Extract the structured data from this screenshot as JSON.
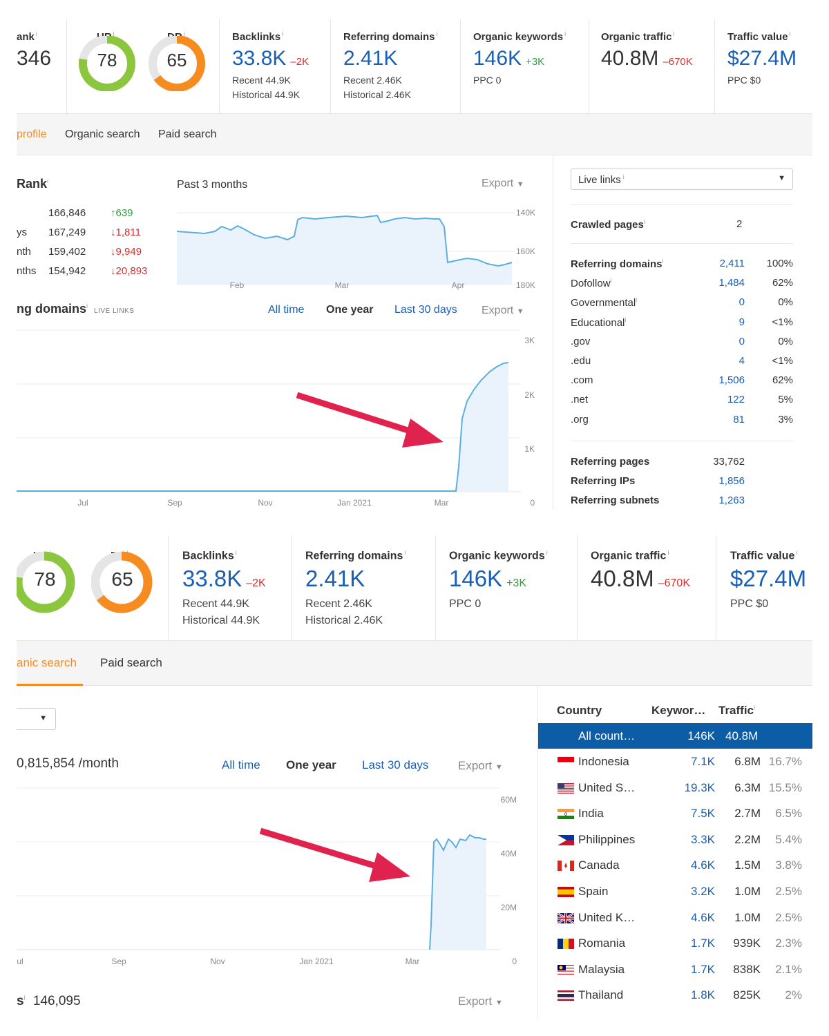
{
  "panel1": {
    "metrics": {
      "rank_label": "ank",
      "rank_value": "346",
      "ur_label": "UR",
      "ur_value": "78",
      "dr_label": "DR",
      "dr_value": "65",
      "backlinks_label": "Backlinks",
      "backlinks_value": "33.8K",
      "backlinks_delta": "–2K",
      "backlinks_recent": "Recent 44.9K",
      "backlinks_historical": "Historical 44.9K",
      "refdomains_label": "Referring domains",
      "refdomains_value": "2.41K",
      "refdomains_recent": "Recent 2.46K",
      "refdomains_historical": "Historical 2.46K",
      "keywords_label": "Organic keywords",
      "keywords_value": "146K",
      "keywords_delta": "+3K",
      "keywords_ppc": "PPC 0",
      "traffic_label": "Organic traffic",
      "traffic_value": "40.8M",
      "traffic_delta": "–670K",
      "value_label": "Traffic value",
      "value_value": "$27.4M",
      "value_ppc": "PPC $0"
    },
    "tabs": [
      "profile",
      "Organic search",
      "Paid search"
    ],
    "rank": {
      "title": "Rank",
      "period": "Past 3 months",
      "export": "Export",
      "rows": [
        {
          "label": "",
          "value": "166,846",
          "change": "↑639",
          "dir": "up"
        },
        {
          "label": "ys",
          "value": "167,249",
          "change": "↓1,811",
          "dir": "down"
        },
        {
          "label": "nth",
          "value": "159,402",
          "change": "↓9,949",
          "dir": "down"
        },
        {
          "label": "nths",
          "value": "154,942",
          "change": "↓20,893",
          "dir": "down"
        }
      ],
      "y_ticks": [
        "140K",
        "160K",
        "180K"
      ],
      "x_ticks": [
        "Feb",
        "Mar",
        "Apr"
      ]
    },
    "refdomains_chart": {
      "title": "ng domains",
      "badge": "LIVE LINKS",
      "filters": [
        "All time",
        "One year",
        "Last 30 days"
      ],
      "export": "Export",
      "y_ticks": [
        "3K",
        "2K",
        "1K",
        "0"
      ],
      "x_ticks": [
        "Jul",
        "Sep",
        "Nov",
        "Jan 2021",
        "Mar"
      ]
    },
    "sidebar": {
      "select_label": "Live links",
      "crawled_label": "Crawled pages",
      "crawled_value": "2",
      "rows": [
        {
          "label": "Referring domains",
          "value": "2,411",
          "pct": "100%",
          "bold": true
        },
        {
          "label": "Dofollow",
          "value": "1,484",
          "pct": "62%",
          "info": true
        },
        {
          "label": "Governmental",
          "value": "0",
          "pct": "0%",
          "info": true
        },
        {
          "label": "Educational",
          "value": "9",
          "pct": "<1%",
          "info": true
        },
        {
          "label": ".gov",
          "value": "0",
          "pct": "0%"
        },
        {
          "label": ".edu",
          "value": "4",
          "pct": "<1%"
        },
        {
          "label": ".com",
          "value": "1,506",
          "pct": "62%"
        },
        {
          "label": ".net",
          "value": "122",
          "pct": "5%"
        },
        {
          "label": ".org",
          "value": "81",
          "pct": "3%"
        }
      ],
      "bottom": [
        {
          "label": "Referring pages",
          "value": "33,762"
        },
        {
          "label": "Referring IPs",
          "value": "1,856"
        },
        {
          "label": "Referring subnets",
          "value": "1,263"
        }
      ]
    }
  },
  "panel2": {
    "tabs": [
      "anic search",
      "Paid search"
    ],
    "traffic_line": "0,815,854 /month",
    "filters": [
      "All time",
      "One year",
      "Last 30 days"
    ],
    "export": "Export",
    "y_ticks": [
      "60M",
      "40M",
      "20M",
      "0"
    ],
    "x_ticks": [
      "ul",
      "Sep",
      "Nov",
      "Jan 2021",
      "Mar"
    ],
    "keywords_line": "146,095",
    "country_table": {
      "headers": [
        "Country",
        "Keywor…",
        "Traffic"
      ],
      "all_row": {
        "name": "All count…",
        "keywords": "146K",
        "traffic": "40.8M"
      },
      "rows": [
        {
          "name": "Indonesia",
          "keywords": "7.1K",
          "traffic": "6.8M",
          "pct": "16.7%",
          "flag": "id"
        },
        {
          "name": "United S…",
          "keywords": "19.3K",
          "traffic": "6.3M",
          "pct": "15.5%",
          "flag": "us"
        },
        {
          "name": "India",
          "keywords": "7.5K",
          "traffic": "2.7M",
          "pct": "6.5%",
          "flag": "in"
        },
        {
          "name": "Philippines",
          "keywords": "3.3K",
          "traffic": "2.2M",
          "pct": "5.4%",
          "flag": "ph"
        },
        {
          "name": "Canada",
          "keywords": "4.6K",
          "traffic": "1.5M",
          "pct": "3.8%",
          "flag": "ca"
        },
        {
          "name": "Spain",
          "keywords": "3.2K",
          "traffic": "1.0M",
          "pct": "2.5%",
          "flag": "es"
        },
        {
          "name": "United K…",
          "keywords": "4.6K",
          "traffic": "1.0M",
          "pct": "2.5%",
          "flag": "gb"
        },
        {
          "name": "Romania",
          "keywords": "1.7K",
          "traffic": "939K",
          "pct": "2.3%",
          "flag": "ro"
        },
        {
          "name": "Malaysia",
          "keywords": "1.7K",
          "traffic": "838K",
          "pct": "2.1%",
          "flag": "my"
        },
        {
          "name": "Thailand",
          "keywords": "1.8K",
          "traffic": "825K",
          "pct": "2%",
          "flag": "th"
        }
      ]
    }
  },
  "colors": {
    "accent": "#f68b1f",
    "link": "#1a5fb4",
    "arrow": "#e0224f",
    "line": "#5aaee0",
    "ur_gauge": "#8cc63f",
    "dr_gauge": "#f68b1f",
    "selected_row": "#0d5ca6"
  }
}
